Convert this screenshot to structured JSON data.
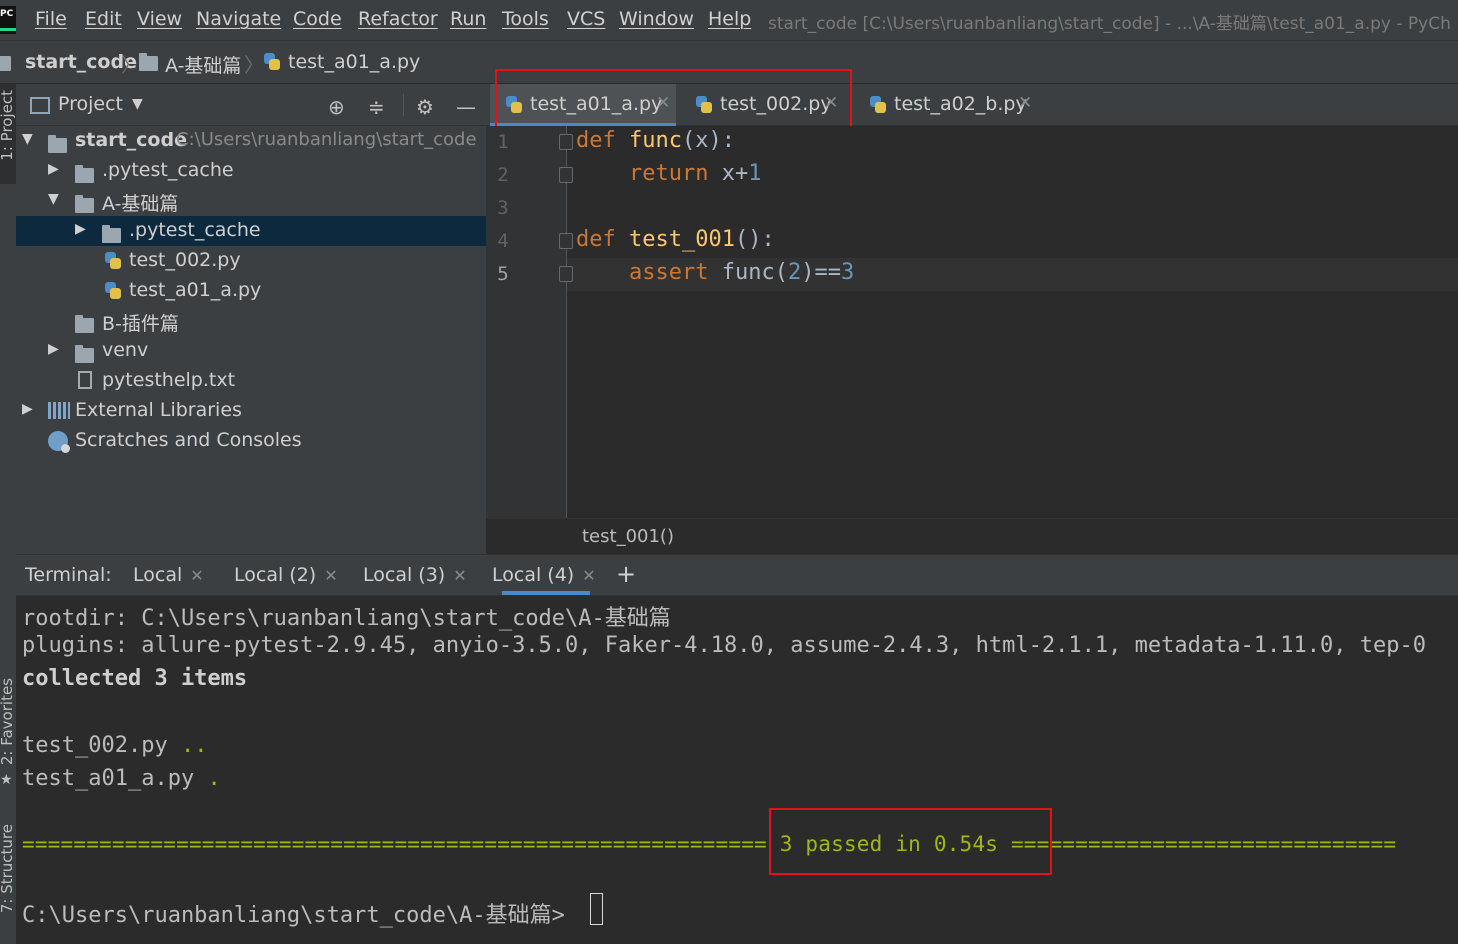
{
  "app": {
    "logo_text": "PC",
    "window_title": "start_code [C:\\Users\\ruanbanliang\\start_code] - ...\\A-基础篇\\test_a01_a.py - PyCh"
  },
  "menu": [
    "File",
    "Edit",
    "View",
    "Navigate",
    "Code",
    "Refactor",
    "Run",
    "Tools",
    "VCS",
    "Window",
    "Help"
  ],
  "breadcrumb": [
    "start_code",
    "A-基础篇",
    "test_a01_a.py"
  ],
  "left_stripe": {
    "project": "1: Project",
    "favorites": "2: Favorites",
    "structure": "7: Structure"
  },
  "project_panel": {
    "title": "Project",
    "tree": [
      {
        "label": "start_code",
        "path": "C:\\Users\\ruanbanliang\\start_code"
      },
      {
        "label": ".pytest_cache"
      },
      {
        "label": "A-基础篇"
      },
      {
        "label": ".pytest_cache"
      },
      {
        "label": "test_002.py"
      },
      {
        "label": "test_a01_a.py"
      },
      {
        "label": "B-插件篇"
      },
      {
        "label": "venv"
      },
      {
        "label": "pytesthelp.txt"
      },
      {
        "label": "External Libraries"
      },
      {
        "label": "Scratches and Consoles"
      }
    ]
  },
  "editor": {
    "tabs": [
      "test_a01_a.py",
      "test_002.py",
      "test_a02_b.py"
    ],
    "active_tab": "test_a01_a.py",
    "line_numbers": [
      "1",
      "2",
      "3",
      "4",
      "5"
    ],
    "code": {
      "l1_kw": "def",
      "l1_fn": "func",
      "l1_rest": "(x):",
      "l2_kw": "return",
      "l2_rest": "x+",
      "l2_num": "1",
      "l4_kw": "def",
      "l4_fn": "test_001",
      "l4_rest": "():",
      "l5_kw": "assert",
      "l5_rest": "func(",
      "l5_num1": "2",
      "l5_rest2": ")==",
      "l5_num2": "3"
    },
    "breadcrumb": "test_001()"
  },
  "terminal": {
    "label": "Terminal:",
    "tabs": [
      "Local",
      "Local (2)",
      "Local (3)",
      "Local (4)"
    ],
    "active_tab": "Local (4)",
    "add_label": "+",
    "lines": {
      "rootdir": "rootdir: C:\\Users\\ruanbanliang\\start_code\\A-基础篇",
      "plugins": "plugins: allure-pytest-2.9.45, anyio-3.5.0, Faker-4.18.0, assume-2.4.3, html-2.1.1, metadata-1.11.0, tep-0",
      "collected": "collected 3 items",
      "t1_name": "test_002.py",
      "t1_dots": "..",
      "t2_name": "test_a01_a.py",
      "t2_dots": ".",
      "summary_left": "==========================================================",
      "summary": "3 passed in 0.54s",
      "summary_right": "==============================",
      "prompt": "C:\\Users\\ruanbanliang\\start_code\\A-基础篇>"
    }
  },
  "colors": {
    "accent": "#4a88c7",
    "highlight_box": "#e5111a",
    "pass_green": "#a0b80f"
  }
}
